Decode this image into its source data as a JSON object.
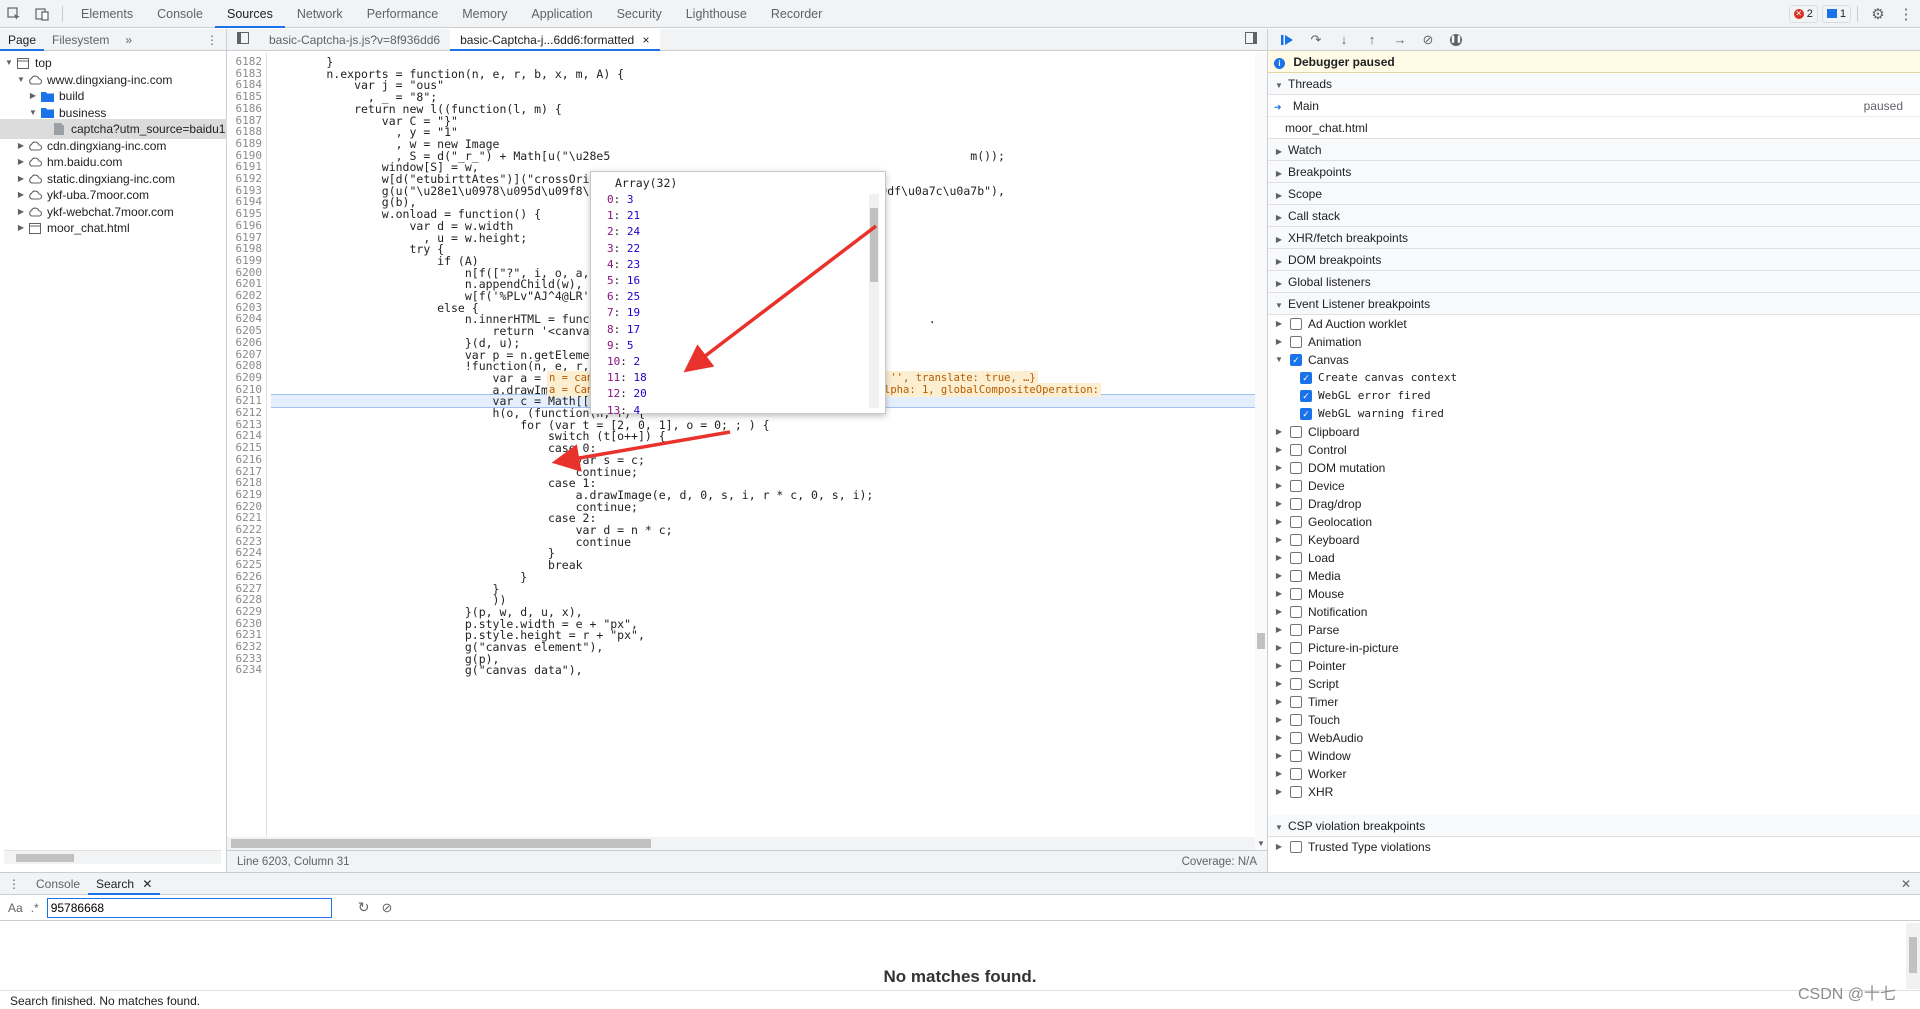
{
  "topbar": {
    "tabs": [
      "Elements",
      "Console",
      "Sources",
      "Network",
      "Performance",
      "Memory",
      "Application",
      "Security",
      "Lighthouse",
      "Recorder"
    ],
    "active_tab": "Sources",
    "errors_count": "2",
    "messages_count": "1"
  },
  "navigator": {
    "tabs": [
      "Page",
      "Filesystem"
    ],
    "more": "»",
    "tree": [
      {
        "label": "top",
        "indent": 0,
        "icon": "frame-icon",
        "open": true
      },
      {
        "label": "www.dingxiang-inc.com",
        "indent": 1,
        "icon": "cloud-icon",
        "open": true
      },
      {
        "label": "build",
        "indent": 2,
        "icon": "folder-icon",
        "open": false
      },
      {
        "label": "business",
        "indent": 2,
        "icon": "folder-icon",
        "open": true
      },
      {
        "label": "captcha?utm_source=baidu1",
        "indent": 3,
        "icon": "file-icon",
        "selected": true
      },
      {
        "label": "cdn.dingxiang-inc.com",
        "indent": 1,
        "icon": "cloud-icon",
        "open": false
      },
      {
        "label": "hm.baidu.com",
        "indent": 1,
        "icon": "cloud-icon",
        "open": false
      },
      {
        "label": "static.dingxiang-inc.com",
        "indent": 1,
        "icon": "cloud-icon",
        "open": false
      },
      {
        "label": "ykf-uba.7moor.com",
        "indent": 1,
        "icon": "cloud-icon",
        "open": false
      },
      {
        "label": "ykf-webchat.7moor.com",
        "indent": 1,
        "icon": "cloud-icon",
        "open": false
      },
      {
        "label": "moor_chat.html",
        "indent": 1,
        "icon": "frame-icon",
        "open": false
      }
    ]
  },
  "editor": {
    "tabs": [
      "basic-Captcha-js.js?v=8f936dd6",
      "basic-Captcha-j...6dd6:formatted"
    ],
    "close": "×",
    "status_left": "Line 6203, Column 31",
    "status_right": "Coverage: N/A",
    "lines": [
      {
        "n": "6182",
        "t": "        }"
      },
      {
        "n": "6183",
        "t": "        n.exports = function(n, e, r, b, x, m, A) {"
      },
      {
        "n": "6184",
        "t": "            var j = \"ous\""
      },
      {
        "n": "6185",
        "t": "              , _ = \"8\";"
      },
      {
        "n": "6186",
        "t": "            return new l((function(l, m) {"
      },
      {
        "n": "6187",
        "t": "                var C = \"}\""
      },
      {
        "n": "6188",
        "t": "                  , y = \"1\""
      },
      {
        "n": "6189",
        "t": "                  , w = new Image"
      },
      {
        "n": "6190",
        "t": "                  , S = d(\"_r_\") + Math[u(\"\\u28e5                                                    m());"
      },
      {
        "n": "6191",
        "t": "                window[S] = w,"
      },
      {
        "n": "6192",
        "t": "                w[d(\"etubirttAtes\")](\"crossOrigi"
      },
      {
        "n": "6193",
        "t": "                g(u(\"\\u28e1\\u0978\\u095d\\u09f8\\u09                         u09dc\\u099d\\u09df\\u0a7c\\u0a7b\"),"
      },
      {
        "n": "6194",
        "t": "                g(b),"
      },
      {
        "n": "6195",
        "t": "                w.onload = function() {"
      },
      {
        "n": "6196",
        "t": "                    var d = w.width"
      },
      {
        "n": "6197",
        "t": "                      , u = w.height;"
      },
      {
        "n": "6198",
        "t": "                    try {"
      },
      {
        "n": "6199",
        "t": "                        if (A)"
      },
      {
        "n": "6200",
        "t": "                            n[f([\"?\", i, o, a, c,"
      },
      {
        "n": "6201",
        "t": "                            n.appendChild(w),"
      },
      {
        "n": "6202",
        "t": "                            w[f('%PLv\"AJ^4@LR')]("
      },
      {
        "n": "6203",
        "t": "                        else {"
      },
      {
        "n": "6204",
        "t": "                            n.innerHTML = functio                                              ."
      },
      {
        "n": "6205",
        "t": "                                return '<canvas w"
      },
      {
        "n": "6206",
        "t": "                            }(d, u);"
      },
      {
        "n": "6207",
        "t": "                            var p = n.getElementsB agName(\"canvas\")[0];"
      },
      {
        "n": "6208",
        "t": "                            !function(n, e, r, i, o) {"
      },
      {
        "n": "6209",
        "t": "                                var a = n.getContext(\"2d\");"
      },
      {
        "n": "6210",
        "t": "                                a.drawImage(e, 0, 0, r, i);"
      },
      {
        "n": "6211",
        "t": "                                var c = Math[[\"floo\", t].join(\"\")](r / o.length);"
      },
      {
        "n": "6212",
        "t": "                                h(o, (function(n, r) {"
      },
      {
        "n": "6213",
        "t": "                                    for (var t = [2, 0, 1], o = 0; ; ) {"
      },
      {
        "n": "6214",
        "t": "                                        switch (t[o++]) {"
      },
      {
        "n": "6215",
        "t": "                                        case 0:"
      },
      {
        "n": "6216",
        "t": "                                            var s = c;"
      },
      {
        "n": "6217",
        "t": "                                            continue;"
      },
      {
        "n": "6218",
        "t": "                                        case 1:"
      },
      {
        "n": "6219",
        "t": "                                            a.drawImage(e, d, 0, s, i, r * c, 0, s, i);"
      },
      {
        "n": "6220",
        "t": "                                            continue;"
      },
      {
        "n": "6221",
        "t": "                                        case 2:"
      },
      {
        "n": "6222",
        "t": "                                            var d = n * c;"
      },
      {
        "n": "6223",
        "t": "                                            continue"
      },
      {
        "n": "6224",
        "t": "                                        }"
      },
      {
        "n": "6225",
        "t": "                                        break"
      },
      {
        "n": "6226",
        "t": "                                    }"
      },
      {
        "n": "6227",
        "t": "                                }"
      },
      {
        "n": "6228",
        "t": "                                ))"
      },
      {
        "n": "6229",
        "t": "                            }(p, w, d, u, x),"
      },
      {
        "n": "6230",
        "t": "                            p.style.width = e + \"px\","
      },
      {
        "n": "6231",
        "t": "                            p.style.height = r + \"px\","
      },
      {
        "n": "6232",
        "t": "                            g(\"canvas element\"),"
      },
      {
        "n": "6233",
        "t": "                            g(p),"
      },
      {
        "n": "6234",
        "t": "                            g(\"canvas data\"),"
      }
    ],
    "inline_values": {
      "l6209": "n = canvas {width: 400, height: 200, title: '', lang: '', translate: true, …}",
      "l6210": "a = CanvasRenderingContext2D {canvas: canvas, globalAlpha: 1, globalCompositeOperation:"
    }
  },
  "popover": {
    "title": "Array(32)",
    "items": [
      {
        "k": "0",
        "v": "3"
      },
      {
        "k": "1",
        "v": "21"
      },
      {
        "k": "2",
        "v": "24"
      },
      {
        "k": "3",
        "v": "22"
      },
      {
        "k": "4",
        "v": "23"
      },
      {
        "k": "5",
        "v": "16"
      },
      {
        "k": "6",
        "v": "25"
      },
      {
        "k": "7",
        "v": "19"
      },
      {
        "k": "8",
        "v": "17"
      },
      {
        "k": "9",
        "v": "5"
      },
      {
        "k": "10",
        "v": "2"
      },
      {
        "k": "11",
        "v": "18"
      },
      {
        "k": "12",
        "v": "20"
      },
      {
        "k": "13",
        "v": "4"
      }
    ]
  },
  "debugger": {
    "paused_banner": "Debugger paused",
    "threads_label": "Threads",
    "thread_main": "Main",
    "thread_status": "paused",
    "thread_second": "moor_chat.html",
    "sections": [
      "Watch",
      "Breakpoints",
      "Scope",
      "Call stack",
      "XHR/fetch breakpoints",
      "DOM breakpoints",
      "Global listeners",
      "Event Listener breakpoints"
    ],
    "event_items": [
      {
        "label": "Ad Auction worklet",
        "checked": false
      },
      {
        "label": "Animation",
        "checked": false
      },
      {
        "label": "Canvas",
        "checked": true,
        "open": true
      },
      {
        "label": "Create canvas context",
        "checked": true,
        "child": true
      },
      {
        "label": "WebGL error fired",
        "checked": true,
        "child": true
      },
      {
        "label": "WebGL warning fired",
        "checked": true,
        "child": true
      },
      {
        "label": "Clipboard",
        "checked": false
      },
      {
        "label": "Control",
        "checked": false
      },
      {
        "label": "DOM mutation",
        "checked": false
      },
      {
        "label": "Device",
        "checked": false
      },
      {
        "label": "Drag/drop",
        "checked": false
      },
      {
        "label": "Geolocation",
        "checked": false
      },
      {
        "label": "Keyboard",
        "checked": false
      },
      {
        "label": "Load",
        "checked": false
      },
      {
        "label": "Media",
        "checked": false
      },
      {
        "label": "Mouse",
        "checked": false
      },
      {
        "label": "Notification",
        "checked": false
      },
      {
        "label": "Parse",
        "checked": false
      },
      {
        "label": "Picture-in-picture",
        "checked": false
      },
      {
        "label": "Pointer",
        "checked": false
      },
      {
        "label": "Script",
        "checked": false
      },
      {
        "label": "Timer",
        "checked": false
      },
      {
        "label": "Touch",
        "checked": false
      },
      {
        "label": "WebAudio",
        "checked": false
      },
      {
        "label": "Window",
        "checked": false
      },
      {
        "label": "Worker",
        "checked": false
      },
      {
        "label": "XHR",
        "checked": false
      }
    ],
    "csp_label": "CSP violation breakpoints",
    "csp_item": "Trusted Type violations"
  },
  "drawer": {
    "tabs": [
      "Console",
      "Search"
    ],
    "active_tab": "Search",
    "aa": "Aa",
    "regex": ".*",
    "query": "95786668",
    "no_matches": "No matches found.",
    "status": "Search finished.  No matches found.",
    "watermark": "CSDN @十七"
  },
  "colors": {
    "accent": "#1a73e8",
    "arrow": "#e8322b",
    "paused_bg": "#fffbe6"
  }
}
